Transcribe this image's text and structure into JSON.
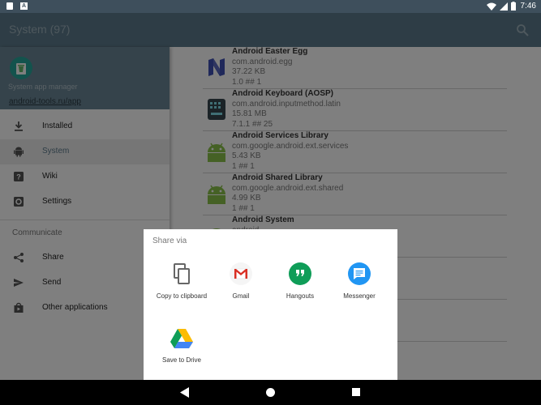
{
  "status_bar": {
    "time": "7:46"
  },
  "app_bar": {
    "title": "System (97)"
  },
  "drawer": {
    "subtitle": "System app manager",
    "link": "android-tools.ru/app",
    "items": [
      {
        "label": "Installed",
        "icon": "download-icon"
      },
      {
        "label": "System",
        "icon": "android-icon"
      },
      {
        "label": "Wiki",
        "icon": "help-icon"
      },
      {
        "label": "Settings",
        "icon": "settings-icon"
      }
    ],
    "section_label": "Communicate",
    "communicate_items": [
      {
        "label": "Share",
        "icon": "share-icon"
      },
      {
        "label": "Send",
        "icon": "send-icon"
      },
      {
        "label": "Other applications",
        "icon": "store-icon"
      }
    ]
  },
  "apps": [
    {
      "name": "Android Easter Egg",
      "package": "com.android.egg",
      "size": "37.22 KB",
      "version": "1.0 ## 1"
    },
    {
      "name": "Android Keyboard (AOSP)",
      "package": "com.android.inputmethod.latin",
      "size": "15.81 MB",
      "version": "7.1.1 ## 25"
    },
    {
      "name": "Android Services Library",
      "package": "com.google.android.ext.services",
      "size": "5.43 KB",
      "version": "1 ## 1"
    },
    {
      "name": "Android Shared Library",
      "package": "com.google.android.ext.shared",
      "size": "4.99 KB",
      "version": "1 ## 1"
    },
    {
      "name": "Android System",
      "package": "android",
      "size": "",
      "version": ""
    }
  ],
  "share_sheet": {
    "title": "Share via",
    "targets": [
      {
        "label": "Copy to clipboard",
        "icon": "copy-icon"
      },
      {
        "label": "Gmail",
        "icon": "gmail-icon"
      },
      {
        "label": "Hangouts",
        "icon": "hangouts-icon"
      },
      {
        "label": "Messenger",
        "icon": "messenger-icon"
      },
      {
        "label": "Save to Drive",
        "icon": "drive-icon"
      }
    ]
  },
  "colors": {
    "app_bar": "#5d7b8c",
    "android_green": "#8bc34a",
    "hangouts_green": "#0f9d58",
    "messenger_blue": "#2196f3"
  }
}
